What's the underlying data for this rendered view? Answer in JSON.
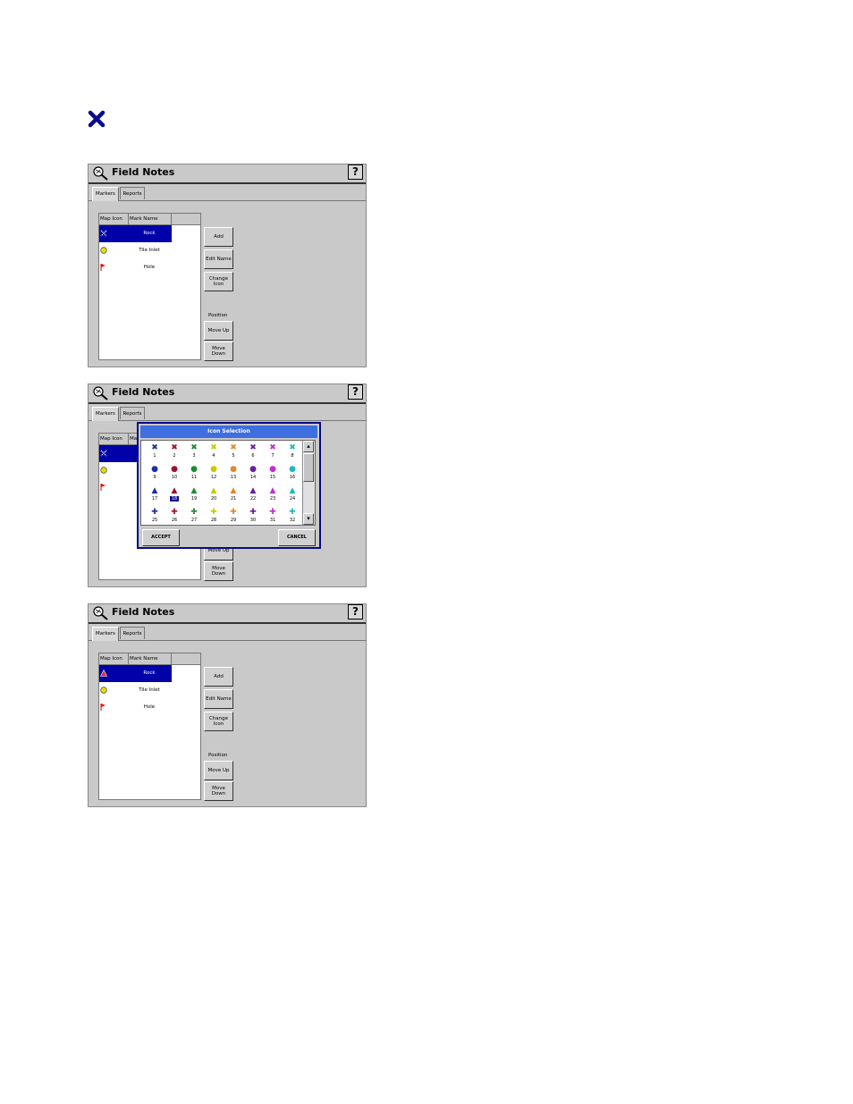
{
  "header_icon": "blue-x-marker-icon",
  "panels": [
    {
      "title": "Field Notes",
      "help": "?",
      "tabs": [
        "Markers",
        "Reports"
      ],
      "columns": [
        "Map Icon",
        "Mark Name"
      ],
      "rows": [
        {
          "icon": "blue-x-icon",
          "name": "Rock",
          "selected": true
        },
        {
          "icon": "yellow-circle-icon",
          "name": "Tile Inlet",
          "selected": false
        },
        {
          "icon": "red-flag-icon",
          "name": "Hole",
          "selected": false
        }
      ],
      "buttons": {
        "add": "Add",
        "edit_name": "Edit Name",
        "change_icon": "Change Icon",
        "move_up": "Move Up",
        "move_down": "Move Down"
      },
      "position_label": "Position"
    },
    {
      "title": "Field Notes",
      "help": "?",
      "tabs": [
        "Markers",
        "Reports"
      ],
      "columns": [
        "Map Icon",
        "Ma"
      ],
      "rows": [
        {
          "icon": "blue-x-icon",
          "name": "",
          "selected": true
        },
        {
          "icon": "yellow-circle-icon",
          "name": "",
          "selected": false
        },
        {
          "icon": "red-flag-icon",
          "name": "",
          "selected": false
        }
      ],
      "buttons": {
        "move_up": "Move Up",
        "move_down": "Move Down"
      },
      "dialog": {
        "title": "Icon Selection",
        "accept": "ACCEPT",
        "cancel": "CANCEL",
        "selected_number": 18,
        "rows": [
          {
            "glyph": "✖",
            "numbers": [
              1,
              2,
              3,
              4,
              5,
              6,
              7,
              8
            ]
          },
          {
            "glyph": "●",
            "numbers": [
              9,
              10,
              11,
              12,
              13,
              14,
              15,
              16
            ]
          },
          {
            "glyph": "▲",
            "numbers": [
              17,
              18,
              19,
              20,
              21,
              22,
              23,
              24
            ]
          },
          {
            "glyph": "✚",
            "numbers": [
              25,
              26,
              27,
              28,
              29,
              30,
              31,
              32
            ]
          }
        ],
        "colors": [
          "#1b2fa8",
          "#a0102a",
          "#1d8a2f",
          "#c8c800",
          "#e0892a",
          "#6a1ea0",
          "#c02ed0",
          "#1fb8c0"
        ]
      }
    },
    {
      "title": "Field Notes",
      "help": "?",
      "tabs": [
        "Markers",
        "Reports"
      ],
      "columns": [
        "Map Icon",
        "Mark Name"
      ],
      "rows": [
        {
          "icon": "red-triangle-icon",
          "name": "Rock",
          "selected": true
        },
        {
          "icon": "yellow-circle-icon",
          "name": "Tile Inlet",
          "selected": false
        },
        {
          "icon": "red-flag-icon",
          "name": "Hole",
          "selected": false
        }
      ],
      "buttons": {
        "add": "Add",
        "edit_name": "Edit Name",
        "change_icon": "Change Icon",
        "move_up": "Move Up",
        "move_down": "Move Down"
      },
      "position_label": "Position"
    }
  ]
}
